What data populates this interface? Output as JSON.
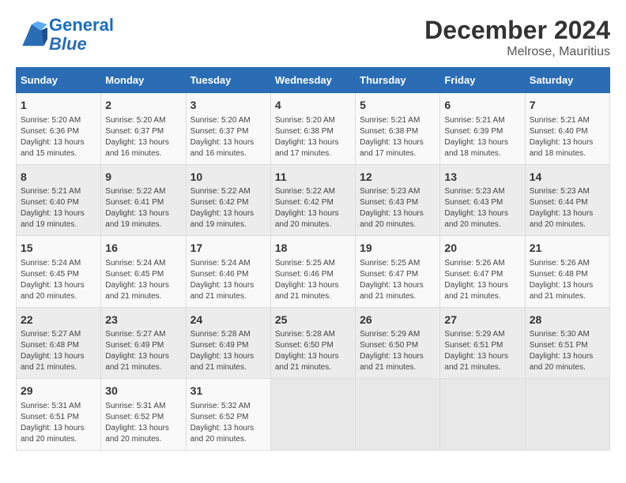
{
  "logo": {
    "line1": "General",
    "line2": "Blue"
  },
  "title": "December 2024",
  "subtitle": "Melrose, Mauritius",
  "days_of_week": [
    "Sunday",
    "Monday",
    "Tuesday",
    "Wednesday",
    "Thursday",
    "Friday",
    "Saturday"
  ],
  "weeks": [
    [
      {
        "day": "1",
        "detail": "Sunrise: 5:20 AM\nSunset: 6:36 PM\nDaylight: 13 hours\nand 15 minutes."
      },
      {
        "day": "2",
        "detail": "Sunrise: 5:20 AM\nSunset: 6:37 PM\nDaylight: 13 hours\nand 16 minutes."
      },
      {
        "day": "3",
        "detail": "Sunrise: 5:20 AM\nSunset: 6:37 PM\nDaylight: 13 hours\nand 16 minutes."
      },
      {
        "day": "4",
        "detail": "Sunrise: 5:20 AM\nSunset: 6:38 PM\nDaylight: 13 hours\nand 17 minutes."
      },
      {
        "day": "5",
        "detail": "Sunrise: 5:21 AM\nSunset: 6:38 PM\nDaylight: 13 hours\nand 17 minutes."
      },
      {
        "day": "6",
        "detail": "Sunrise: 5:21 AM\nSunset: 6:39 PM\nDaylight: 13 hours\nand 18 minutes."
      },
      {
        "day": "7",
        "detail": "Sunrise: 5:21 AM\nSunset: 6:40 PM\nDaylight: 13 hours\nand 18 minutes."
      }
    ],
    [
      {
        "day": "8",
        "detail": "Sunrise: 5:21 AM\nSunset: 6:40 PM\nDaylight: 13 hours\nand 19 minutes."
      },
      {
        "day": "9",
        "detail": "Sunrise: 5:22 AM\nSunset: 6:41 PM\nDaylight: 13 hours\nand 19 minutes."
      },
      {
        "day": "10",
        "detail": "Sunrise: 5:22 AM\nSunset: 6:42 PM\nDaylight: 13 hours\nand 19 minutes."
      },
      {
        "day": "11",
        "detail": "Sunrise: 5:22 AM\nSunset: 6:42 PM\nDaylight: 13 hours\nand 20 minutes."
      },
      {
        "day": "12",
        "detail": "Sunrise: 5:23 AM\nSunset: 6:43 PM\nDaylight: 13 hours\nand 20 minutes."
      },
      {
        "day": "13",
        "detail": "Sunrise: 5:23 AM\nSunset: 6:43 PM\nDaylight: 13 hours\nand 20 minutes."
      },
      {
        "day": "14",
        "detail": "Sunrise: 5:23 AM\nSunset: 6:44 PM\nDaylight: 13 hours\nand 20 minutes."
      }
    ],
    [
      {
        "day": "15",
        "detail": "Sunrise: 5:24 AM\nSunset: 6:45 PM\nDaylight: 13 hours\nand 20 minutes."
      },
      {
        "day": "16",
        "detail": "Sunrise: 5:24 AM\nSunset: 6:45 PM\nDaylight: 13 hours\nand 21 minutes."
      },
      {
        "day": "17",
        "detail": "Sunrise: 5:24 AM\nSunset: 6:46 PM\nDaylight: 13 hours\nand 21 minutes."
      },
      {
        "day": "18",
        "detail": "Sunrise: 5:25 AM\nSunset: 6:46 PM\nDaylight: 13 hours\nand 21 minutes."
      },
      {
        "day": "19",
        "detail": "Sunrise: 5:25 AM\nSunset: 6:47 PM\nDaylight: 13 hours\nand 21 minutes."
      },
      {
        "day": "20",
        "detail": "Sunrise: 5:26 AM\nSunset: 6:47 PM\nDaylight: 13 hours\nand 21 minutes."
      },
      {
        "day": "21",
        "detail": "Sunrise: 5:26 AM\nSunset: 6:48 PM\nDaylight: 13 hours\nand 21 minutes."
      }
    ],
    [
      {
        "day": "22",
        "detail": "Sunrise: 5:27 AM\nSunset: 6:48 PM\nDaylight: 13 hours\nand 21 minutes."
      },
      {
        "day": "23",
        "detail": "Sunrise: 5:27 AM\nSunset: 6:49 PM\nDaylight: 13 hours\nand 21 minutes."
      },
      {
        "day": "24",
        "detail": "Sunrise: 5:28 AM\nSunset: 6:49 PM\nDaylight: 13 hours\nand 21 minutes."
      },
      {
        "day": "25",
        "detail": "Sunrise: 5:28 AM\nSunset: 6:50 PM\nDaylight: 13 hours\nand 21 minutes."
      },
      {
        "day": "26",
        "detail": "Sunrise: 5:29 AM\nSunset: 6:50 PM\nDaylight: 13 hours\nand 21 minutes."
      },
      {
        "day": "27",
        "detail": "Sunrise: 5:29 AM\nSunset: 6:51 PM\nDaylight: 13 hours\nand 21 minutes."
      },
      {
        "day": "28",
        "detail": "Sunrise: 5:30 AM\nSunset: 6:51 PM\nDaylight: 13 hours\nand 20 minutes."
      }
    ],
    [
      {
        "day": "29",
        "detail": "Sunrise: 5:31 AM\nSunset: 6:51 PM\nDaylight: 13 hours\nand 20 minutes."
      },
      {
        "day": "30",
        "detail": "Sunrise: 5:31 AM\nSunset: 6:52 PM\nDaylight: 13 hours\nand 20 minutes."
      },
      {
        "day": "31",
        "detail": "Sunrise: 5:32 AM\nSunset: 6:52 PM\nDaylight: 13 hours\nand 20 minutes."
      },
      null,
      null,
      null,
      null
    ]
  ]
}
